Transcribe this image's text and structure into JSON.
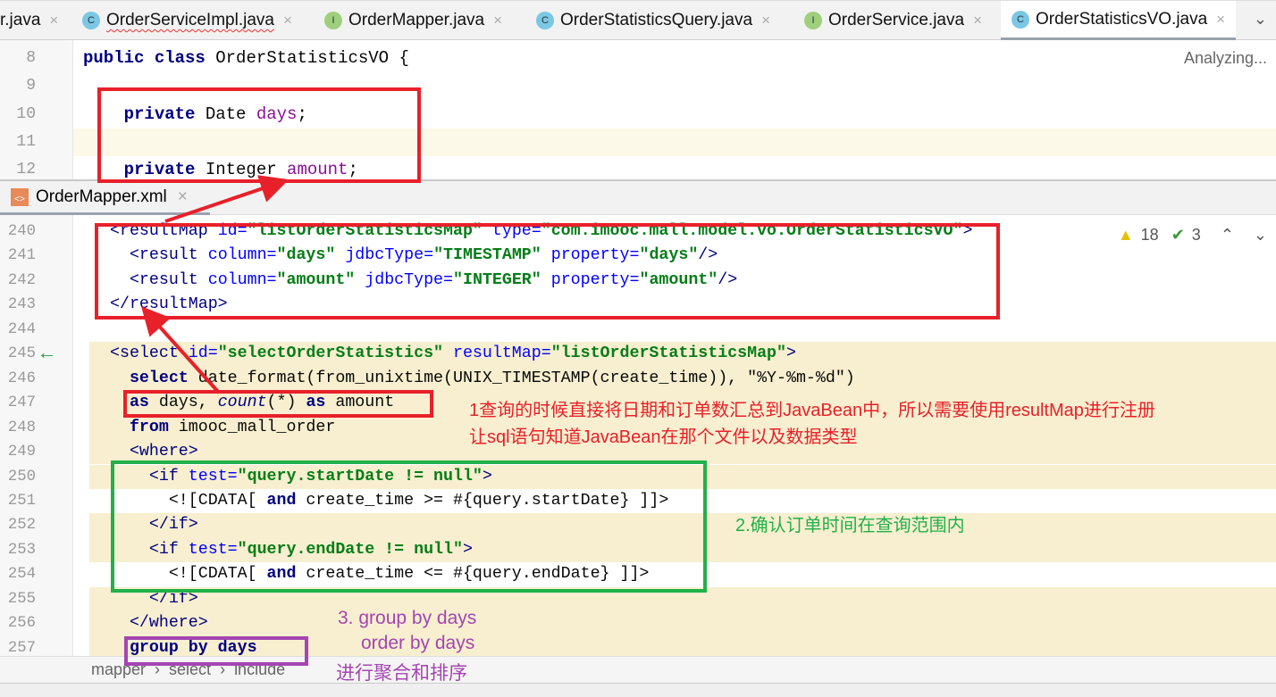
{
  "tabs": [
    {
      "label": "r.java",
      "icon": "",
      "active": false
    },
    {
      "label": "OrderServiceImpl.java",
      "icon": "C",
      "active": false,
      "error": true
    },
    {
      "label": "OrderMapper.java",
      "icon": "I",
      "active": false
    },
    {
      "label": "OrderStatisticsQuery.java",
      "icon": "C",
      "active": false
    },
    {
      "label": "OrderService.java",
      "icon": "I",
      "active": false
    },
    {
      "label": "OrderStatisticsVO.java",
      "icon": "C",
      "active": true
    }
  ],
  "top_editor": {
    "status": "Analyzing...",
    "lines": [
      {
        "n": "8",
        "tokens": [
          [
            "public class ",
            "kw"
          ],
          [
            "OrderStatisticsVO {",
            "plain"
          ]
        ]
      },
      {
        "n": "9",
        "tokens": []
      },
      {
        "n": "10",
        "tokens": [
          [
            "    private ",
            "kw"
          ],
          [
            "Date ",
            "plain"
          ],
          [
            "days",
            "prop"
          ],
          [
            ";",
            "plain"
          ]
        ]
      },
      {
        "n": "11",
        "tokens": [],
        "current": true
      },
      {
        "n": "12",
        "tokens": [
          [
            "    private ",
            "kw"
          ],
          [
            "Integer ",
            "plain"
          ],
          [
            "amount",
            "prop"
          ],
          [
            ";",
            "plain"
          ]
        ]
      }
    ]
  },
  "bottom_tab": {
    "label": "OrderMapper.xml"
  },
  "inspections": {
    "warnings": "18",
    "ok": "3"
  },
  "bottom_editor": {
    "lines": [
      {
        "n": "240",
        "tokens": [
          [
            "<resultMap ",
            "tag"
          ],
          [
            "id=",
            "attr"
          ],
          [
            "\"listOrderStatisticsMap\" ",
            "str"
          ],
          [
            "type=",
            "attr"
          ],
          [
            "\"com.imooc.mall.model.vo.OrderStatisticsVO\"",
            "str"
          ],
          [
            ">",
            "tag"
          ]
        ]
      },
      {
        "n": "241",
        "tokens": [
          [
            "  <result ",
            "tag"
          ],
          [
            "column=",
            "attr"
          ],
          [
            "\"days\" ",
            "str"
          ],
          [
            "jdbcType=",
            "attr"
          ],
          [
            "\"TIMESTAMP\" ",
            "str"
          ],
          [
            "property=",
            "attr"
          ],
          [
            "\"days\"",
            "str"
          ],
          [
            "/>",
            "tag"
          ]
        ]
      },
      {
        "n": "242",
        "tokens": [
          [
            "  <result ",
            "tag"
          ],
          [
            "column=",
            "attr"
          ],
          [
            "\"amount\" ",
            "str"
          ],
          [
            "jdbcType=",
            "attr"
          ],
          [
            "\"INTEGER\" ",
            "str"
          ],
          [
            "property=",
            "attr"
          ],
          [
            "\"amount\"",
            "str"
          ],
          [
            "/>",
            "tag"
          ]
        ]
      },
      {
        "n": "243",
        "tokens": [
          [
            "</resultMap>",
            "tag"
          ]
        ]
      },
      {
        "n": "244",
        "tokens": []
      },
      {
        "n": "245",
        "tokens": [
          [
            "<select ",
            "tag"
          ],
          [
            "id=",
            "attr"
          ],
          [
            "\"selectOrderStatistics\" ",
            "str"
          ],
          [
            "resultMap=",
            "attr"
          ],
          [
            "\"listOrderStatisticsMap\"",
            "str"
          ],
          [
            ">",
            "tag"
          ]
        ],
        "bg": true,
        "arrow": true
      },
      {
        "n": "246",
        "tokens": [
          [
            "  select ",
            "kw"
          ],
          [
            "date_format(from_unixtime(UNIX_TIMESTAMP(create_time)), \"%Y-%m-%d\")",
            "plain"
          ]
        ],
        "bg": true
      },
      {
        "n": "247",
        "tokens": [
          [
            "  as ",
            "kw"
          ],
          [
            "days, ",
            "plain"
          ],
          [
            "count",
            "it"
          ],
          [
            "(*) ",
            "plain"
          ],
          [
            "as ",
            "kw"
          ],
          [
            "amount",
            "plain"
          ]
        ],
        "bg": true
      },
      {
        "n": "248",
        "tokens": [
          [
            "  from ",
            "kw"
          ],
          [
            "imooc_mall_order",
            "plain"
          ]
        ],
        "bg": true
      },
      {
        "n": "249",
        "tokens": [
          [
            "  <where>",
            "tag"
          ]
        ],
        "bg": true
      },
      {
        "n": "250",
        "tokens": [
          [
            "    <if ",
            "tag"
          ],
          [
            "test=",
            "attr"
          ],
          [
            "\"query.startDate != null\"",
            "str"
          ],
          [
            ">",
            "tag"
          ]
        ],
        "bg": true
      },
      {
        "n": "251",
        "tokens": [
          [
            "      <![CDATA[ ",
            "plain"
          ],
          [
            "and ",
            "kw"
          ],
          [
            "create_time >= #{query.startDate} ]]>",
            "plain"
          ]
        ]
      },
      {
        "n": "252",
        "tokens": [
          [
            "    </if>",
            "tag"
          ]
        ],
        "bg": true
      },
      {
        "n": "253",
        "tokens": [
          [
            "    <if ",
            "tag"
          ],
          [
            "test=",
            "attr"
          ],
          [
            "\"query.endDate != null\"",
            "str"
          ],
          [
            ">",
            "tag"
          ]
        ],
        "bg": true
      },
      {
        "n": "254",
        "tokens": [
          [
            "      <![CDATA[ ",
            "plain"
          ],
          [
            "and ",
            "kw"
          ],
          [
            "create_time <= #{query.endDate} ]]>",
            "plain"
          ]
        ]
      },
      {
        "n": "255",
        "tokens": [
          [
            "    </if>",
            "tag"
          ]
        ],
        "bg": true
      },
      {
        "n": "256",
        "tokens": [
          [
            "  </where>",
            "tag"
          ]
        ],
        "bg": true
      },
      {
        "n": "257",
        "tokens": [
          [
            "  group by days",
            "kw"
          ]
        ],
        "bg": true
      }
    ]
  },
  "breadcrumb": [
    "mapper",
    "select",
    "include"
  ],
  "annotations": {
    "note1_line1": "1查询的时候直接将日期和订单数汇总到JavaBean中，所以需要使用resultMap进行注册",
    "note1_line2": "让sql语句知道JavaBean在那个文件以及数据类型",
    "note2": "2.确认订单时间在查询范围内",
    "note3_line1": "3. group by days",
    "note3_line2": "order by days",
    "note3_line3": "进行聚合和排序"
  },
  "colors": {
    "red": "#e8202a",
    "green": "#22b04a",
    "purple": "#a445b2",
    "highlight": "#f7efcf"
  }
}
